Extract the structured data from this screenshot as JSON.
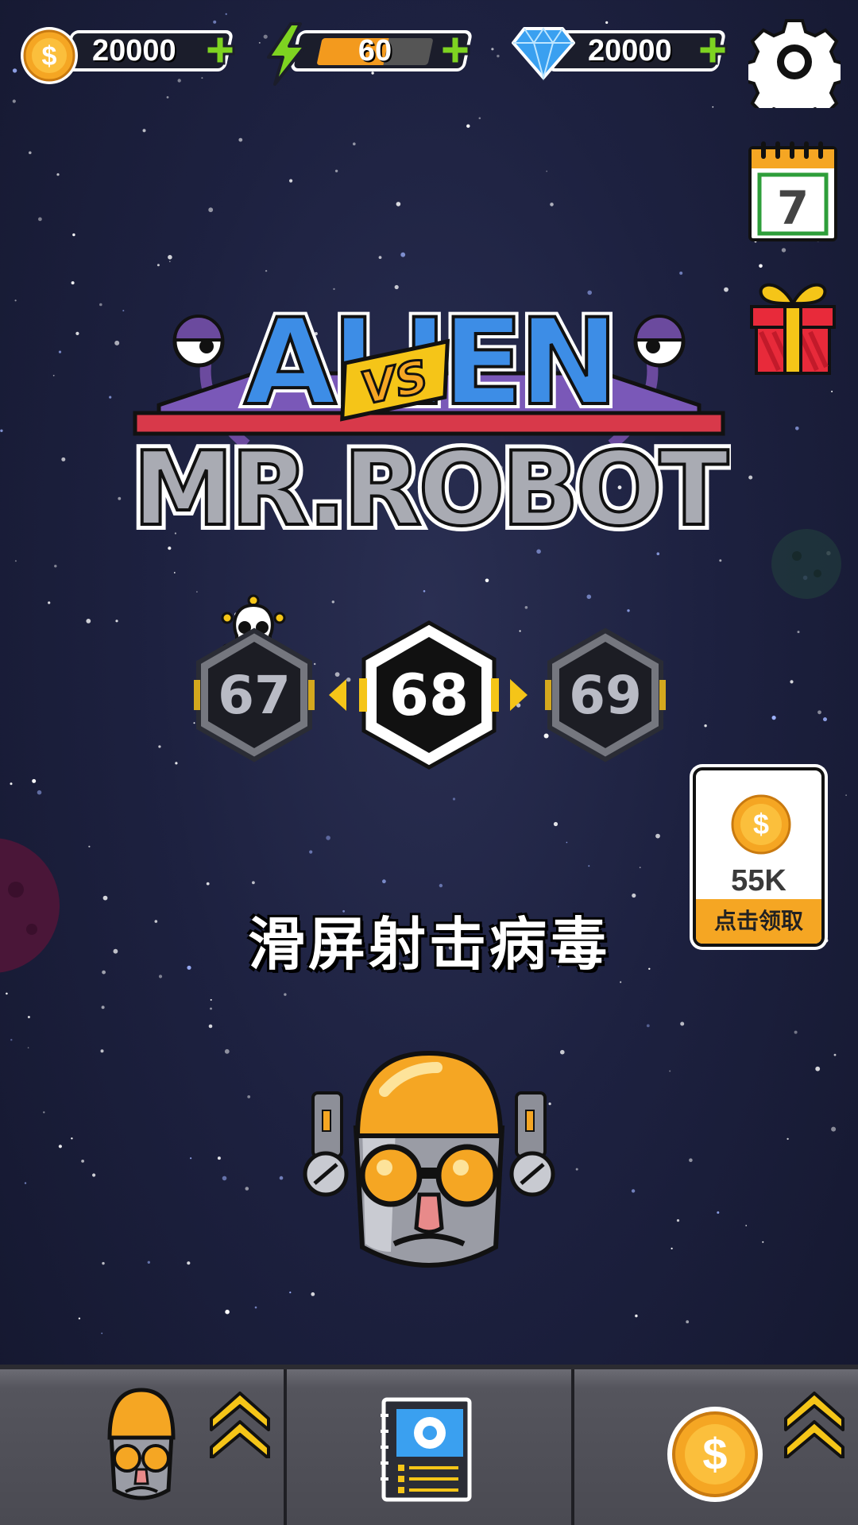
{
  "resources": {
    "coins": "20000",
    "energy": "60",
    "energy_fill": 0.6,
    "gems": "20000"
  },
  "daily_calendar": {
    "day": "7"
  },
  "logo": {
    "line1": "ALIEN",
    "vs": "VS",
    "line2": "MR.ROBOT"
  },
  "levels": {
    "previous": "67",
    "current": "68",
    "next": "69"
  },
  "reward": {
    "amount": "55K",
    "claim_label": "点击领取"
  },
  "hint": "滑屏射击病毒",
  "icons": {
    "coin": "coin-icon",
    "energy": "lightning-icon",
    "gem": "diamond-icon",
    "settings": "gear-icon",
    "calendar": "calendar-icon",
    "gift": "gift-icon",
    "skull": "skull-icon",
    "upgrade": "double-chevron-up-icon",
    "weapons": "weapon-book-icon"
  },
  "colors": {
    "accent_orange": "#f5a623",
    "plus_green": "#7ed321",
    "bg_dark": "#1d2140"
  }
}
